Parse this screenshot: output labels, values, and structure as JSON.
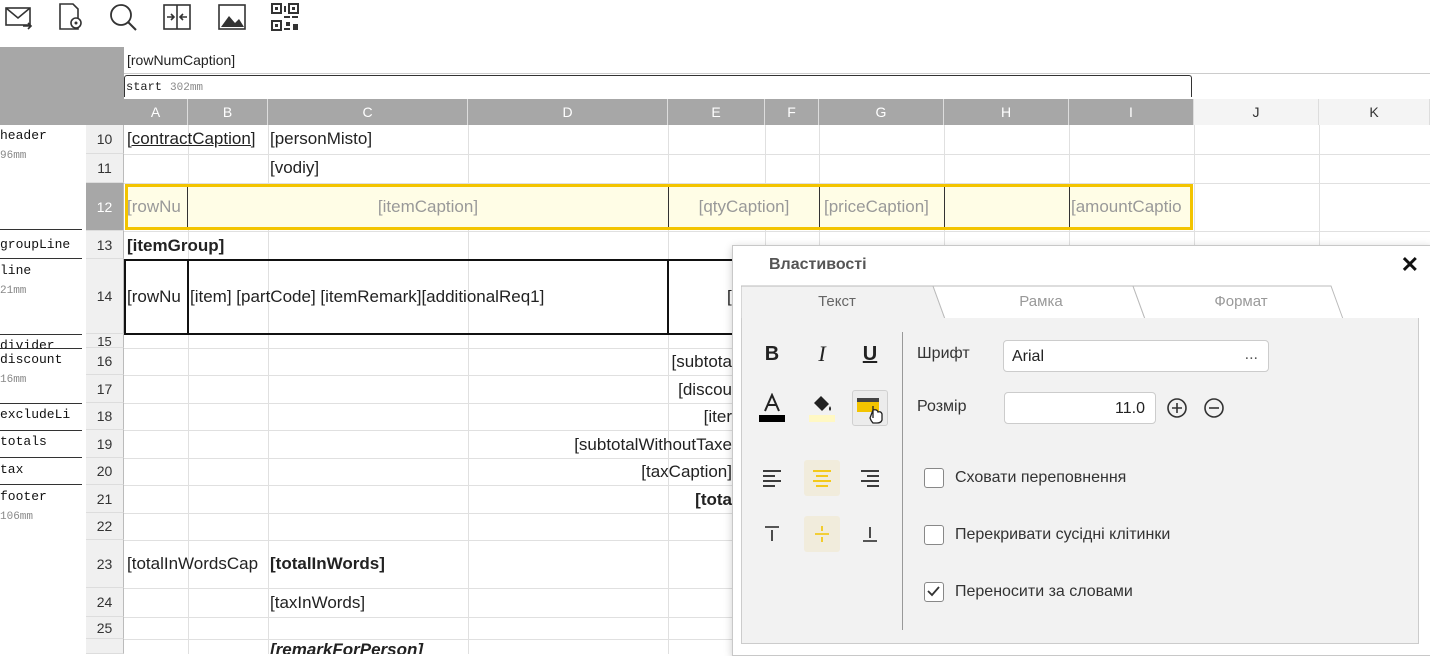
{
  "toolbar": {
    "icons": [
      "email-icon",
      "page-settings-icon",
      "search-icon",
      "merge-cells-icon",
      "image-icon",
      "qr-code-icon"
    ]
  },
  "sheet": {
    "row_num_caption": "[rowNumCaption]",
    "start_band": {
      "name": "start",
      "size": "302mm"
    },
    "columns": [
      "A",
      "B",
      "C",
      "D",
      "E",
      "F",
      "G",
      "H",
      "I",
      "J",
      "K"
    ],
    "bands": [
      {
        "name": "header",
        "size": "96mm"
      },
      {
        "name": "groupLine",
        "size": ""
      },
      {
        "name": "line",
        "size": "21mm"
      },
      {
        "name": "divider",
        "size": ""
      },
      {
        "name": "discount",
        "size": "16mm"
      },
      {
        "name": "excludeLi",
        "size": ""
      },
      {
        "name": "totals",
        "size": ""
      },
      {
        "name": "tax",
        "size": ""
      },
      {
        "name": "footer",
        "size": "106mm"
      }
    ],
    "rows": [
      "10",
      "11",
      "12",
      "13",
      "14",
      "15",
      "16",
      "17",
      "18",
      "19",
      "20",
      "21",
      "22",
      "23",
      "24",
      "25"
    ],
    "cells": {
      "r10_a": "[contractCaption]",
      "r10_c": "[personMisto]",
      "r11_c": "[vodiy]",
      "r12_a": "[rowNu",
      "r12_b": "[itemCaption]",
      "r12_e": "[qtyCaption]",
      "r12_g": "[priceCaption]",
      "r12_i": "[amountCaptio",
      "r13_a": "[itemGroup]",
      "r14_a": "[rowNu",
      "r14_b": "[item] [partCode] [itemRemark][additionalReq1]",
      "r14_e": "[",
      "r16": "[subtota",
      "r17": "[discou",
      "r18": "[iter",
      "r19": "[subtotalWithoutTaxe",
      "r20": "[taxCaption]",
      "r21": "[tota",
      "r23_a": "[totalInWordsCap",
      "r23_c": "[totalInWords]",
      "r24_c": "[taxInWords]",
      "r26_c": "[remarkForPerson]"
    }
  },
  "dialog": {
    "title": "Властивості",
    "tabs": [
      "Текст",
      "Рамка",
      "Формат"
    ],
    "active_tab": "Текст",
    "font_label": "Шрифт",
    "font_value": "Arial",
    "font_more": "...",
    "size_label": "Розмір",
    "size_value": "11.0",
    "checkboxes": [
      {
        "label": "Сховати переповнення",
        "checked": false
      },
      {
        "label": "Перекривати сусідні клітинки",
        "checked": false
      },
      {
        "label": "Переносити за словами",
        "checked": true
      }
    ],
    "colors": {
      "accent": "#f3c400",
      "highlight": "#fffde6"
    }
  }
}
